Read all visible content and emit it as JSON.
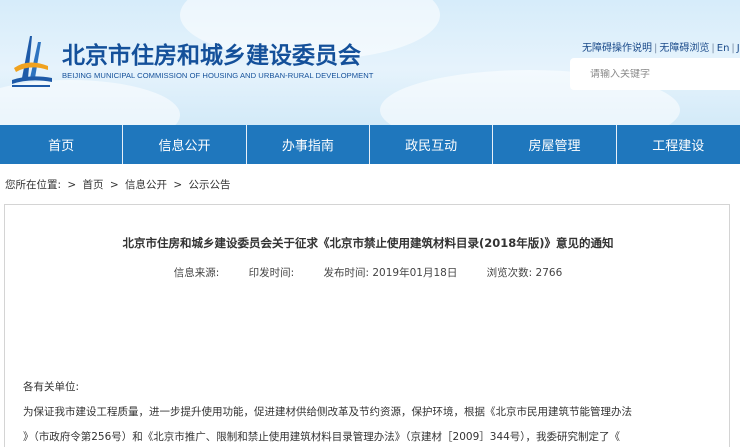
{
  "header": {
    "title": "北京市住房和城乡建设委员会",
    "subtitle": "BEIJING MUNICIPAL COMMISSION OF HOUSING AND URBAN-RURAL DEVELOPMENT",
    "util_links": [
      "无障碍操作说明",
      "无障碍浏览",
      "En",
      "Ji"
    ],
    "search_placeholder": "请输入关键字"
  },
  "nav": {
    "items": [
      "首页",
      "信息公开",
      "办事指南",
      "政民互动",
      "房屋管理",
      "工程建设"
    ]
  },
  "breadcrumb": {
    "prefix": "您所在位置:",
    "items": [
      "首页",
      "信息公开",
      "公示公告"
    ],
    "separator": ">"
  },
  "article": {
    "title": "北京市住房和城乡建设委员会关于征求《北京市禁止使用建筑材料目录(2018年版)》意见的通知",
    "meta": {
      "source_label": "信息来源:",
      "issue_label": "印发时间:",
      "publish": "发布时间:  2019年01月18日",
      "views": "浏览次数:  2766"
    },
    "greeting": "各有关单位:",
    "para_line1": "为保证我市建设工程质量，进一步提升使用功能，促进建材供给侧改革及节约资源，保护环境，根据《北京市民用建筑节能管理办法",
    "para_line2": "》（市政府令第256号）和《北京市推广、限制和禁止使用建筑材料目录管理办法》（京建材［2009］344号），我委研究制定了《"
  },
  "colors": {
    "brand": "#14509a",
    "nav_bg": "#1f77bd"
  }
}
